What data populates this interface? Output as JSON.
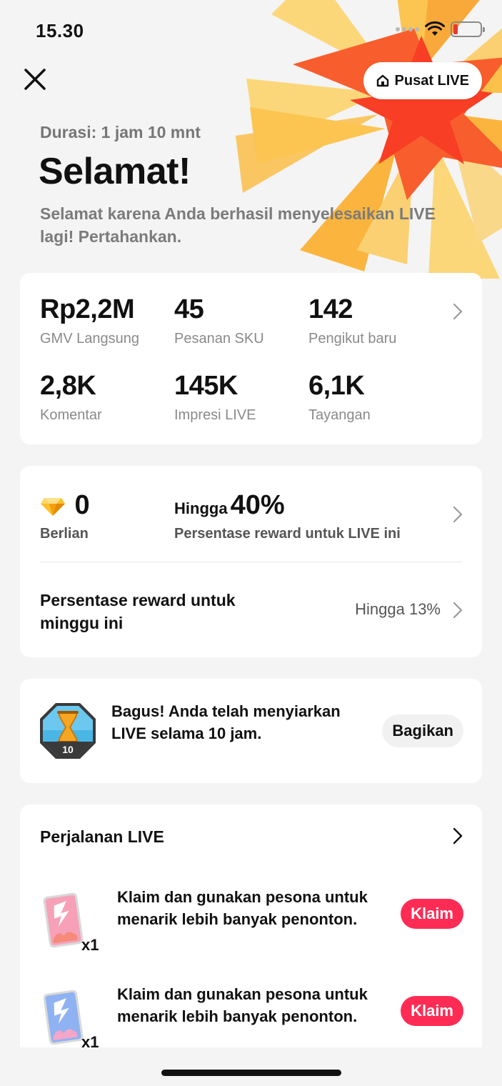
{
  "status_bar": {
    "time": "15.30"
  },
  "header": {
    "pusat_label": "Pusat LIVE",
    "duration": "Durasi: 1 jam 10 mnt",
    "title": "Selamat!",
    "subtitle": "Selamat karena Anda berhasil menyelesaikan LIVE lagi! Pertahankan."
  },
  "stats": [
    {
      "value": "Rp2,2M",
      "label": "GMV Langsung"
    },
    {
      "value": "45",
      "label": "Pesanan SKU"
    },
    {
      "value": "142",
      "label": "Pengikut baru"
    },
    {
      "value": "2,8K",
      "label": "Komentar"
    },
    {
      "value": "145K",
      "label": "Impresi LIVE"
    },
    {
      "value": "6,1K",
      "label": "Tayangan"
    }
  ],
  "rewards": {
    "diamonds_value": "0",
    "diamonds_label": "Berlian",
    "hingga_prefix": "Hingga",
    "percent_value": "40%",
    "percent_label": "Persentase reward untuk LIVE ini",
    "weekly_label": "Persentase reward untuk minggu ini",
    "weekly_value": "Hingga 13%"
  },
  "achievement": {
    "badge_number": "10",
    "text": "Bagus! Anda telah menyiarkan LIVE selama 10 jam.",
    "share_label": "Bagikan"
  },
  "journey": {
    "title": "Perjalanan LIVE",
    "tasks": [
      {
        "text": "Klaim dan gunakan pesona untuk menarik lebih banyak penonton.",
        "quantity": "x1",
        "button": "Klaim",
        "card_color": "pink"
      },
      {
        "text": "Klaim dan gunakan pesona untuk menarik lebih banyak penonton.",
        "quantity": "x1",
        "button": "Klaim",
        "card_color": "blue"
      }
    ]
  },
  "colors": {
    "accent": "#fe2c55",
    "burst_yellow": "#fdd26e",
    "burst_orange": "#fbb03b",
    "burst_red": "#f83e25"
  },
  "icons": {
    "close": "close-icon",
    "home": "home-icon",
    "chevron": "chevron-right-icon",
    "diamond": "diamond-icon",
    "badge": "hourglass-badge-icon",
    "charm": "charm-card-icon"
  }
}
